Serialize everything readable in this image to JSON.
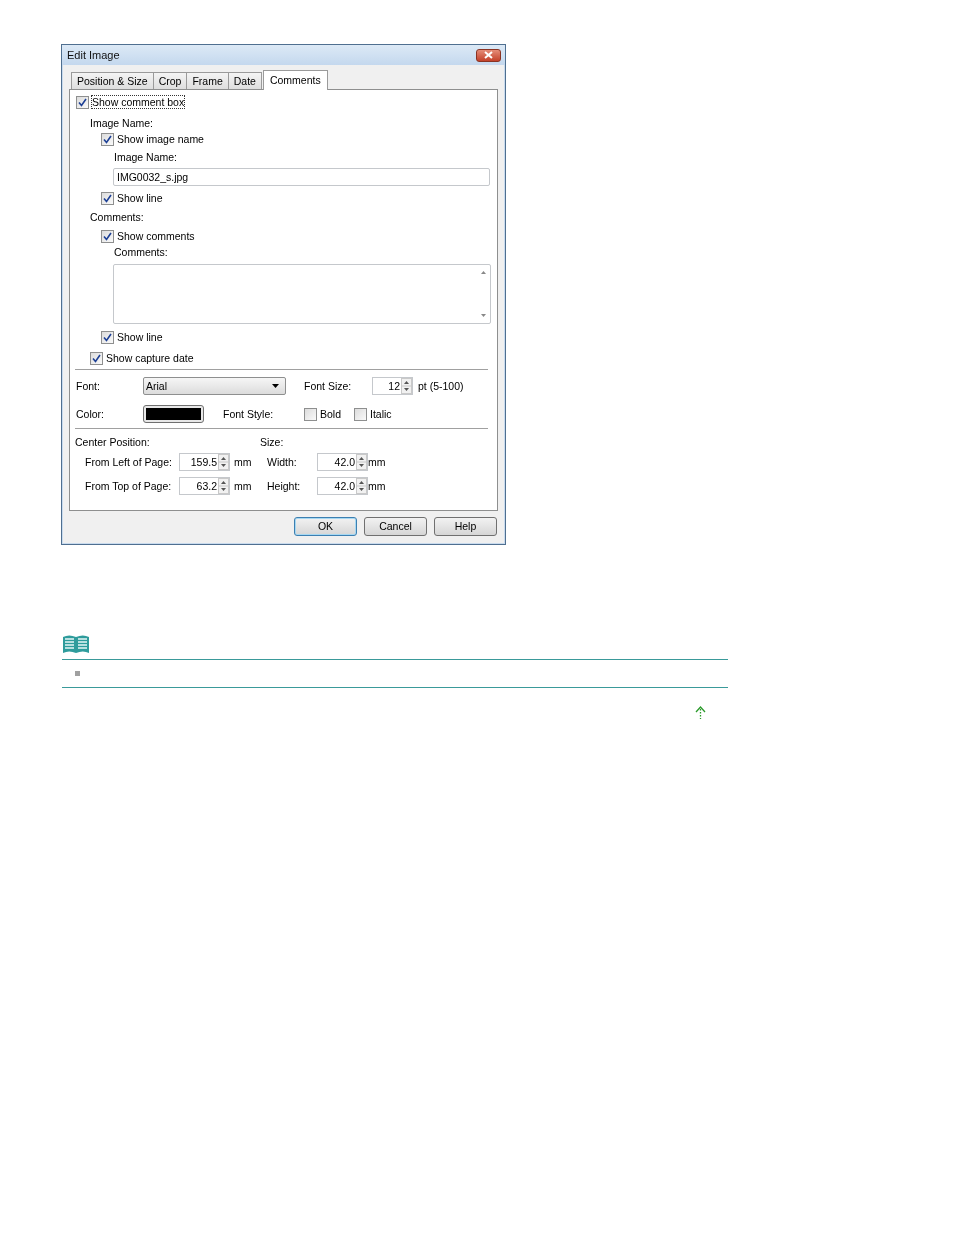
{
  "window": {
    "title": "Edit Image"
  },
  "tabs": [
    {
      "label": "Position & Size",
      "selected": false
    },
    {
      "label": "Crop",
      "selected": false
    },
    {
      "label": "Frame",
      "selected": false
    },
    {
      "label": "Date",
      "selected": false
    },
    {
      "label": "Comments",
      "selected": true
    }
  ],
  "comment_box": {
    "label": "Show comment box",
    "checked": true
  },
  "image_name": {
    "heading": "Image Name:",
    "show": {
      "label": "Show image name",
      "checked": true
    },
    "field_label": "Image Name:",
    "value": "IMG0032_s.jpg",
    "show_line": {
      "label": "Show line",
      "checked": true
    }
  },
  "comments": {
    "heading": "Comments:",
    "show": {
      "label": "Show comments",
      "checked": true
    },
    "field_label": "Comments:",
    "show_line": {
      "label": "Show line",
      "checked": true
    }
  },
  "capture_date": {
    "label": "Show capture date",
    "checked": true
  },
  "font": {
    "label": "Font:",
    "value": "Arial"
  },
  "font_size": {
    "label": "Font Size:",
    "value": "12",
    "unit": "pt (5-100)"
  },
  "color": {
    "label": "Color:",
    "color": "#000000"
  },
  "font_style": {
    "label": "Font Style:",
    "options": [
      {
        "label": "Bold",
        "checked": false
      },
      {
        "label": "Italic",
        "checked": false
      }
    ]
  },
  "center_position": {
    "heading": "Center Position:",
    "fields": [
      {
        "label": "From Left of Page:",
        "value": "159.5",
        "unit": "mm"
      },
      {
        "label": "From Top of Page:",
        "value": "63.2",
        "unit": "mm"
      }
    ]
  },
  "size": {
    "heading": "Size:",
    "fields": [
      {
        "label": "Width:",
        "value": "42.0",
        "unit": "mm"
      },
      {
        "label": "Height:",
        "value": "42.0",
        "unit": "mm"
      }
    ]
  },
  "buttons": [
    {
      "label": "OK",
      "default": true
    },
    {
      "label": "Cancel",
      "default": false
    },
    {
      "label": "Help",
      "default": false
    }
  ]
}
